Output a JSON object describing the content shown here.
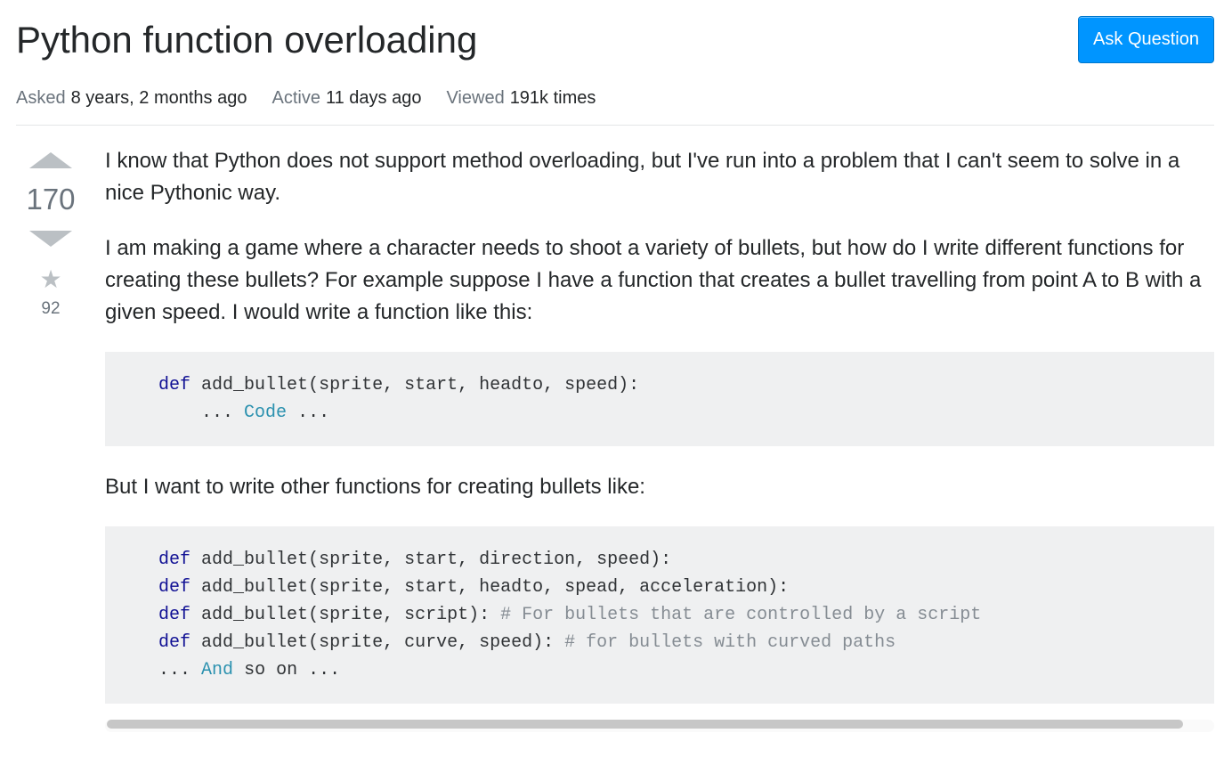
{
  "header": {
    "title": "Python function overloading",
    "ask_button": "Ask Question"
  },
  "meta": {
    "asked_label": "Asked",
    "asked_value": "8 years, 2 months ago",
    "active_label": "Active",
    "active_value": "11 days ago",
    "viewed_label": "Viewed",
    "viewed_value": "191k times"
  },
  "vote": {
    "score": "170",
    "favorites": "92"
  },
  "post": {
    "para1": "I know that Python does not support method overloading, but I've run into a problem that I can't seem to solve in a nice Pythonic way.",
    "para2": "I am making a game where a character needs to shoot a variety of bullets, but how do I write different functions for creating these bullets? For example suppose I have a function that creates a bullet travelling from point A to B with a given speed. I would write a function like this:",
    "para3": "But I want to write other functions for creating bullets like:",
    "code1": {
      "kw_def": "def",
      "fn": "add_bullet",
      "sig": "(sprite, start, headto, speed):",
      "ellipsis1": "...",
      "cls_code": "Code",
      "ellipsis2": "..."
    },
    "code2": {
      "kw_def": "def",
      "fn": "add_bullet",
      "sig1": "(sprite, start, direction, speed):",
      "sig2": "(sprite, start, headto, spead, acceleration):",
      "sig3": "(sprite, script):",
      "com3": "# For bullets that are controlled by a script",
      "sig4": "(sprite, curve, speed):",
      "com4": "# for bullets with curved paths",
      "ellipsis1": "...",
      "cls_and": "And",
      "rest": "so on ..."
    }
  }
}
